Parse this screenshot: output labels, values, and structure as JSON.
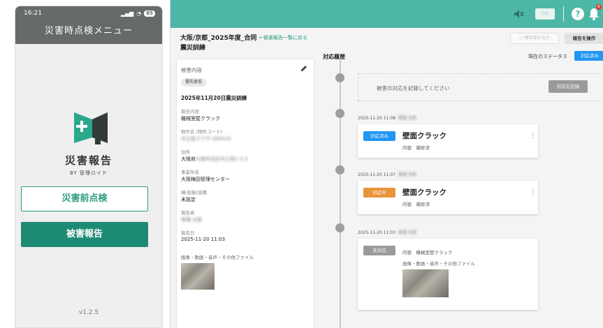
{
  "phone": {
    "status_time": "16:21",
    "battery": "85",
    "title": "災害時点検メニュー",
    "brand_title": "災害報告",
    "brand_sub": "BY 管理ロイド",
    "btn_precheck": "災害前点検",
    "btn_damage": "被害報告",
    "version": "v1.2.5"
  },
  "desktop": {
    "topbar": {
      "user_chip": "管理",
      "help": "?",
      "notification_count": "8"
    },
    "page_title": "大阪/京都_2025年度_合同震災訓練",
    "back_link": "←被害報告一覧に戻る",
    "btn_export": "報告書を出力",
    "btn_operate": "報告を操作",
    "history_heading": "対応履歴",
    "status_label": "現在のステータス",
    "status_value": "対応済み",
    "detail": {
      "heading": "被害内容",
      "priority": "優先度低",
      "title": "2025年11月20日震災訓練",
      "fields": [
        {
          "label": "報告内容",
          "value": "機械室壁クラック",
          "blurred": false
        },
        {
          "label": "物件名 (物件コード)",
          "value": "中之島プラザ (00014)",
          "blurred": true
        },
        {
          "label": "住所",
          "value": "大阪府",
          "value_blurred": "大阪市北区中之島1-2-3",
          "blurred": false
        },
        {
          "label": "事業所名",
          "value": "大阪梅田管理センター",
          "blurred": false
        },
        {
          "label": "棟/部屋/設備",
          "value": "未設定",
          "blurred": false
        },
        {
          "label": "報告者",
          "value": "管理 太郎",
          "blurred": true
        },
        {
          "label": "報告日",
          "value": "2025-11-20 11:03",
          "blurred": false
        }
      ],
      "files_label": "画像・動画・音声・その他ファイル"
    },
    "record_placeholder": "被害の対応を記録してください",
    "record_button": "対応を記録",
    "entries": [
      {
        "timestamp": "2025-11-20 11:08",
        "user": "管理 太郎",
        "badge": "対応済み",
        "badge_color": "#2196f3",
        "title": "壁面クラック",
        "meta": "内容　補修済"
      },
      {
        "timestamp": "2025-11-20 11:07",
        "user": "管理 太郎",
        "badge": "対応中",
        "badge_color": "#e8943a",
        "title": "壁面クラック",
        "meta": "内容　補修済"
      },
      {
        "timestamp": "2025-11-20 11:03",
        "user": "管理 太郎",
        "badge": "未対応",
        "badge_color": "#9a9a9a",
        "meta": "内容　機械室壁クラック",
        "files": "画像・動画・音声・その他ファイル"
      }
    ]
  }
}
